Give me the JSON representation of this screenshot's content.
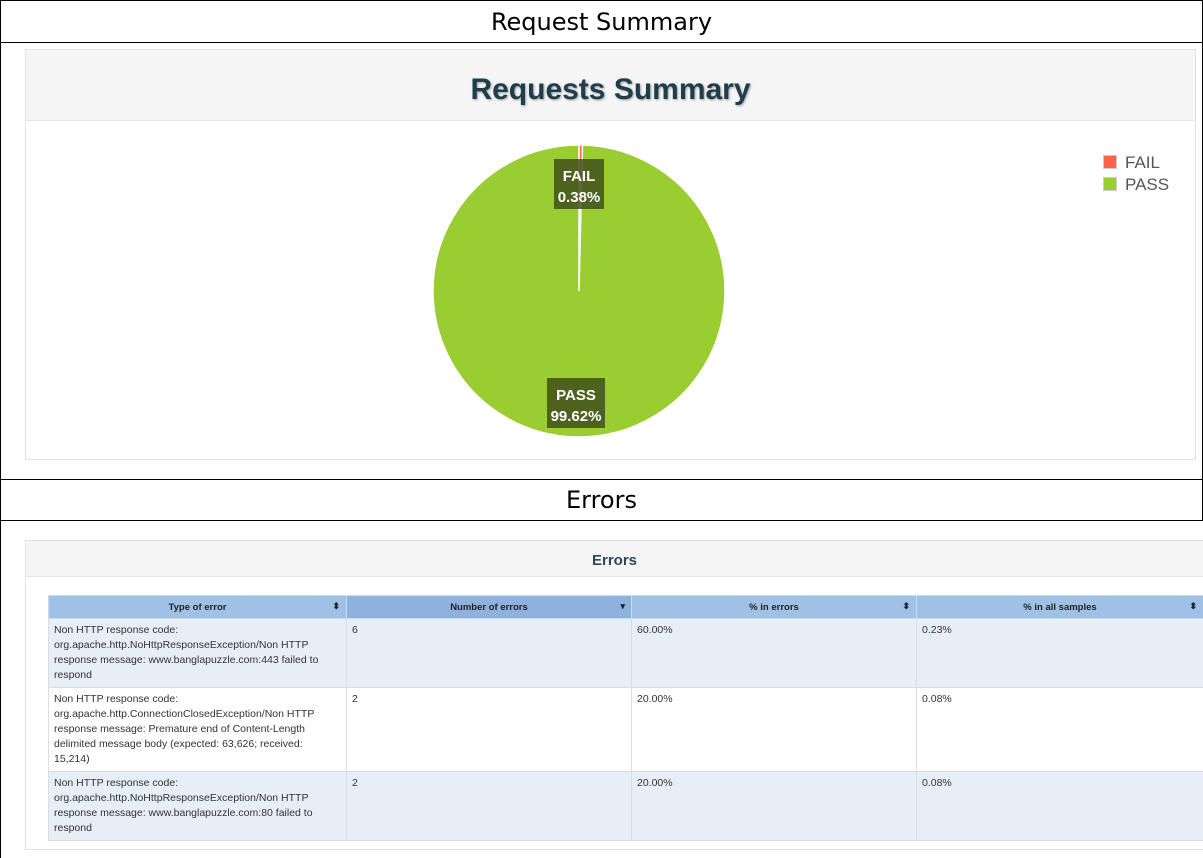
{
  "doc": {
    "section1_heading": "Request Summary",
    "section2_heading": "Errors"
  },
  "summary_panel": {
    "title": "Requests Summary",
    "legend": [
      {
        "label": "FAIL",
        "color": "#ff6347"
      },
      {
        "label": "PASS",
        "color": "#9acd32"
      }
    ]
  },
  "chart_data": {
    "type": "pie",
    "title": "Requests Summary",
    "slices": [
      {
        "label": "FAIL",
        "value": 0.38,
        "display": "0.38%",
        "color": "#ff6347"
      },
      {
        "label": "PASS",
        "value": 99.62,
        "display": "99.62%",
        "color": "#9acd32"
      }
    ],
    "legend_position": "top-right"
  },
  "errors_panel": {
    "title": "Errors",
    "columns": [
      "Type of error",
      "Number of errors",
      "% in errors",
      "% in all samples"
    ],
    "column_sort_icons": [
      "⬍",
      "▾",
      "⬍",
      "⬍"
    ],
    "rows": [
      {
        "type": "Non HTTP response code: org.apache.http.NoHttpResponseException/Non HTTP response message: www.banglapuzzle.com:443 failed to respond",
        "count": "6",
        "pct_errors": "60.00%",
        "pct_samples": "0.23%"
      },
      {
        "type": "Non HTTP response code: org.apache.http.ConnectionClosedException/Non HTTP response message: Premature end of Content-Length delimited message body (expected: 63,626; received: 15,214)",
        "count": "2",
        "pct_errors": "20.00%",
        "pct_samples": "0.08%"
      },
      {
        "type": "Non HTTP response code: org.apache.http.NoHttpResponseException/Non HTTP response message: www.banglapuzzle.com:80 failed to respond",
        "count": "2",
        "pct_errors": "20.00%",
        "pct_samples": "0.08%"
      }
    ]
  }
}
